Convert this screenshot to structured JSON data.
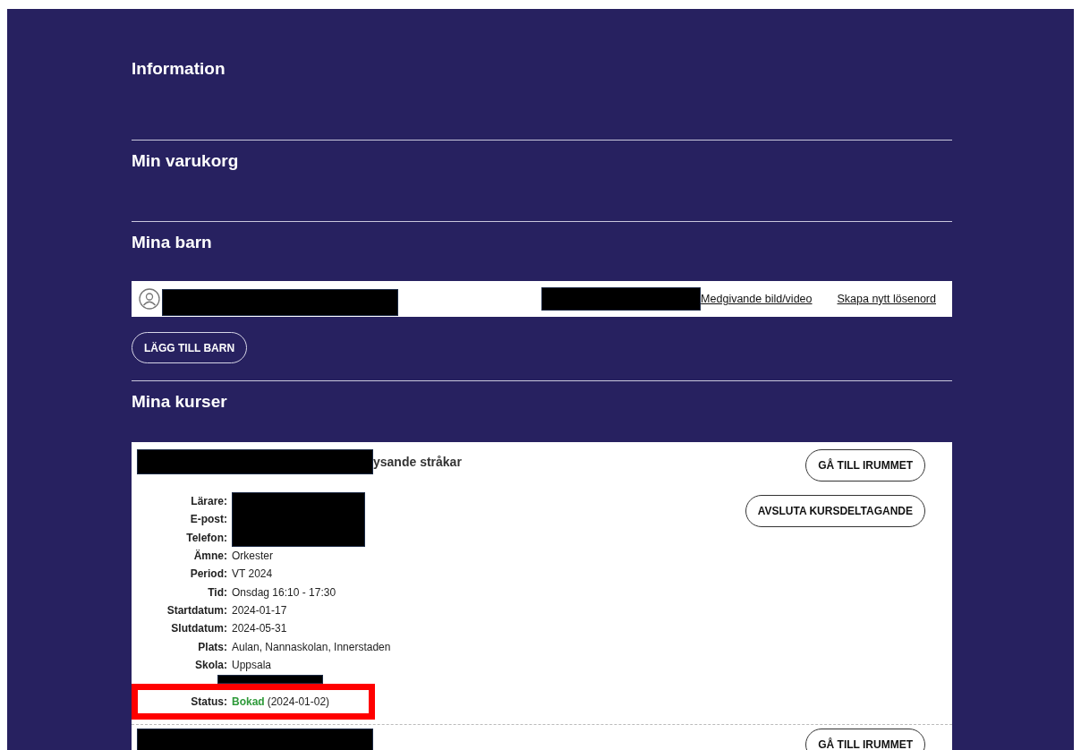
{
  "sections": [
    {
      "heading": "Information"
    },
    {
      "heading": "Min varukorg"
    }
  ],
  "children": {
    "heading": "Mina barn",
    "rows": [
      {
        "links": [
          "Medgivande bild/video",
          "Skapa nytt lösenord"
        ]
      }
    ],
    "add_button": "LÄGG TILL BARN"
  },
  "courses": {
    "heading": "Mina kurser",
    "items": [
      {
        "title": "ysande stråkar",
        "buttons": [
          "GÅ TILL IRUMMET",
          "AVSLUTA KURSDELTAGANDE"
        ],
        "fields": [
          {
            "kind": "redacted",
            "label": "Lärare:"
          },
          {
            "kind": "redacted",
            "label": "E-post:"
          },
          {
            "kind": "redacted",
            "label": "Telefon:"
          },
          {
            "kind": "text",
            "label": "Ämne:",
            "value": "Orkester"
          },
          {
            "kind": "text",
            "label": "Period:",
            "value": "VT 2024"
          },
          {
            "kind": "text",
            "label": "Tid:",
            "value": "Onsdag 16:10 - 17:30"
          },
          {
            "kind": "text",
            "label": "Startdatum:",
            "value": "2024-01-17"
          },
          {
            "kind": "text",
            "label": "Slutdatum:",
            "value": "2024-05-31"
          },
          {
            "kind": "text",
            "label": "Plats:",
            "value": "Aulan, Nannaskolan, Innerstaden"
          },
          {
            "kind": "text",
            "label": "Skola:",
            "value": "Uppsala"
          },
          {
            "kind": "hidden"
          },
          {
            "kind": "status",
            "label": "Status:",
            "value": "Bokad",
            "date": "(2024-01-02)",
            "highlighted": true
          }
        ]
      },
      {
        "buttons": [
          "GÅ TILL IRUMMET"
        ]
      }
    ]
  }
}
